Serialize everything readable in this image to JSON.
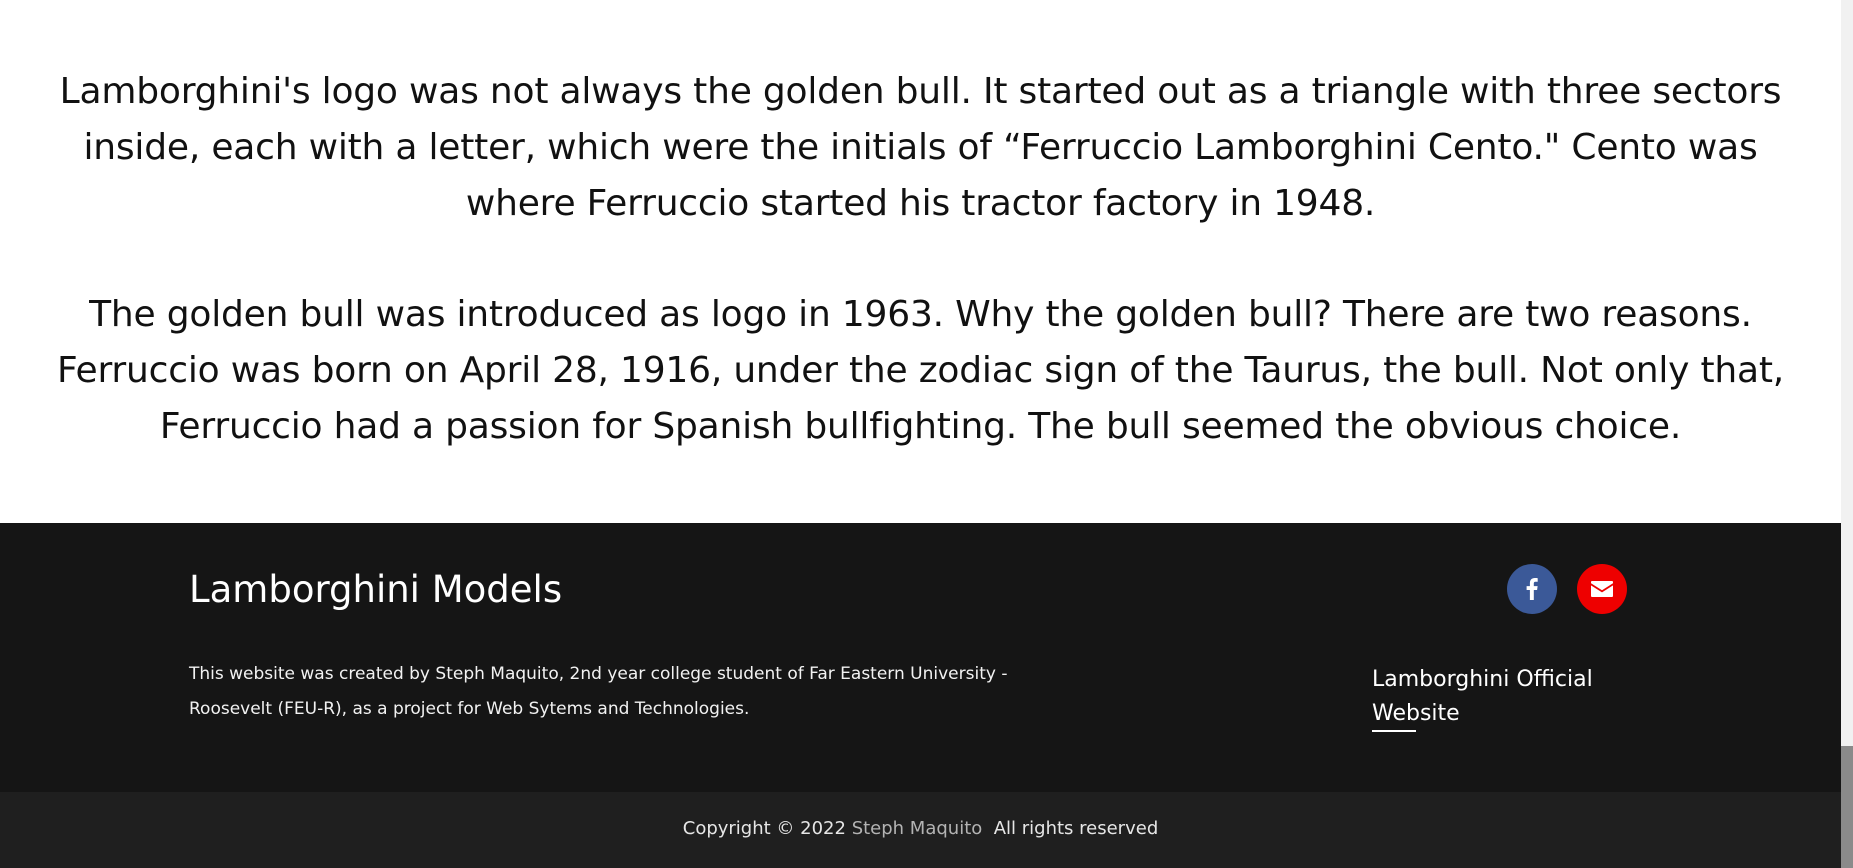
{
  "content": {
    "paragraph_1": "Lamborghini's logo was not always the golden bull. It started out as a triangle with three sectors inside, each with a letter, which were the initials of “Ferruccio Lamborghini Cento.\" Cento was where Ferruccio started his tractor factory in 1948.",
    "paragraph_2": "The golden bull was introduced as logo in 1963. Why the golden bull? There are two reasons. Ferruccio was born on April 28, 1916, under the zodiac sign of the Taurus, the bull. Not only that, Ferruccio had a passion for Spanish bullfighting. The bull seemed the obvious choice."
  },
  "footer": {
    "title": "Lamborghini Models",
    "description": "This website was created by Steph Maquito, 2nd year college student of Far Eastern University - Roosevelt (FEU-R), as a project for Web Sytems and Technologies.",
    "social": [
      {
        "name": "facebook",
        "icon": "facebook-icon",
        "color": "#3b5998"
      },
      {
        "name": "email",
        "icon": "envelope-icon",
        "color": "#ee0000"
      }
    ],
    "official_link_label": "Lamborghini Official Website"
  },
  "copyright": {
    "prefix": "Copyright © 2022 ",
    "author": "Steph Maquito",
    "suffix": "  All rights reserved"
  },
  "colors": {
    "footer_bg": "#151515",
    "copyright_bg": "#1f1f1f",
    "text_dark": "#111111",
    "text_light": "#ffffff"
  }
}
